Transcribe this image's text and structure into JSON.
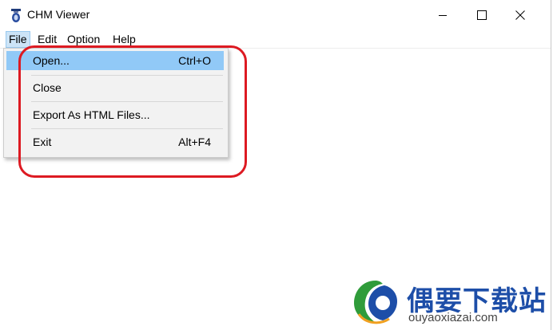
{
  "window": {
    "title": "CHM Viewer"
  },
  "window_controls": {
    "minimize": "minimize-icon",
    "maximize": "maximize-icon",
    "close": "close-icon"
  },
  "menu_bar": {
    "items": [
      "File",
      "Edit",
      "Option",
      "Help"
    ]
  },
  "file_menu": {
    "items": [
      {
        "label": "Open...",
        "shortcut": "Ctrl+O"
      },
      {
        "label": "Close",
        "shortcut": ""
      },
      {
        "label": "Export As HTML Files...",
        "shortcut": ""
      },
      {
        "label": "Exit",
        "shortcut": "Alt+F4"
      }
    ]
  },
  "watermark": {
    "cn_text": "偶要下载站",
    "url": "ouyaoxiazai.com"
  },
  "colors": {
    "highlight": "#91c9f7",
    "annotation": "#dd1a22",
    "watermark_blue": "#1d4ea8"
  }
}
